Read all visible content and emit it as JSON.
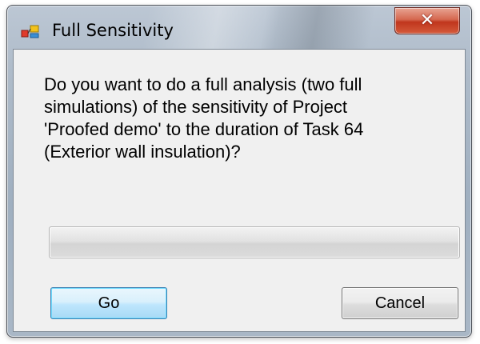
{
  "window": {
    "title": "Full Sensitivity",
    "close_glyph": "✕",
    "icons": {
      "app": "app-icon",
      "close": "close-icon"
    }
  },
  "dialog": {
    "message": "Do you want to do a full analysis (two full\nsimulations) of the sensitivity of Project\n'Proofed demo' to the duration of Task 64\n(Exterior wall insulation)?",
    "progress_fraction": 0,
    "buttons": {
      "go_label": "Go",
      "cancel_label": "Cancel"
    }
  },
  "colors": {
    "accent_button_border": "#3c7fb1",
    "close_button_red": "#c0361d",
    "client_background": "#f0f0f0"
  }
}
